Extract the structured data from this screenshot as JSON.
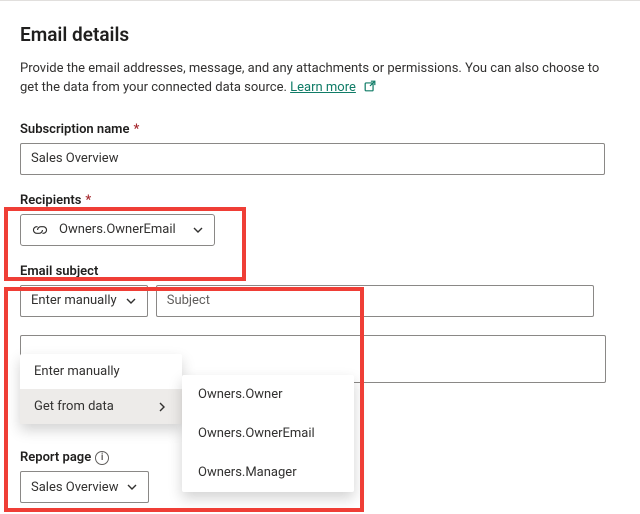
{
  "header": {
    "title": "Email details",
    "intro_a": "Provide the email addresses, message, and any attachments or permissions. You can also choose to get the data from your connected data source. ",
    "learn_more": "Learn more"
  },
  "fields": {
    "subscription_label": "Subscription name",
    "subscription_value": "Sales Overview",
    "recipients_label": "Recipients",
    "recipients_pill": "Owners.OwnerEmail",
    "subject_label": "Email subject",
    "subject_mode": "Enter manually",
    "subject_placeholder": "Subject",
    "report_page_label": "Report page",
    "report_page_value": "Sales Overview"
  },
  "required_marker": "*",
  "subject_menu": {
    "enter_manually": "Enter manually",
    "get_from_data": "Get from data"
  },
  "data_fields_menu": {
    "owner": "Owners.Owner",
    "owner_email": "Owners.OwnerEmail",
    "manager": "Owners.Manager"
  }
}
